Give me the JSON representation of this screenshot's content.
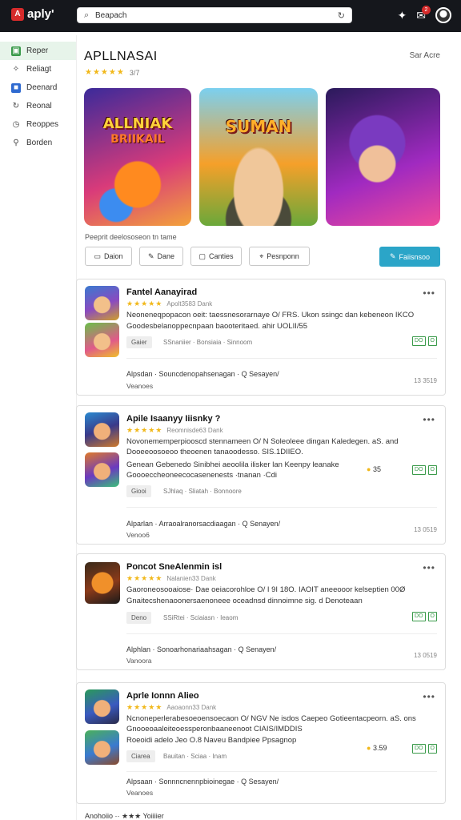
{
  "header": {
    "logo_badge": "A",
    "logo_text": "aply'",
    "search_value": "Beapach",
    "notification_count": "2"
  },
  "sidebar": {
    "items": [
      {
        "label": "Reper",
        "icon": "grid-icon"
      },
      {
        "label": "Reliagt",
        "icon": "trophy-icon"
      },
      {
        "label": "Deenard",
        "icon": "app-icon"
      },
      {
        "label": "Reonal",
        "icon": "refresh-icon"
      },
      {
        "label": "Reoppes",
        "icon": "clock-icon"
      },
      {
        "label": "Borden",
        "icon": "user-icon"
      }
    ]
  },
  "main": {
    "title": "APLLNASAI",
    "sort_label": "Sar Acre",
    "rating_stars": "★★★★★",
    "rating_text": "3/7",
    "hero": [
      {
        "title": "ALLNIAK",
        "subtitle": "BRIIKAIL"
      },
      {
        "title": "SUMAN",
        "subtitle": ""
      },
      {
        "title": "",
        "subtitle": ""
      }
    ],
    "description": "Peeprit deelososeon tn tame",
    "buttons": [
      "Daion",
      "Dane",
      "Canties",
      "Pesnponn"
    ],
    "primary_button": "Faiisnsoo"
  },
  "cards": [
    {
      "title": "Fantel Aanayirad",
      "rating_stars": "★★★★★",
      "rating_text": "Apolt3583 Dank",
      "line1": "Neoneneqpopacon oeit: taessnesorarnaye O/ FRS. Ukon ssingc dan kebeneon IKCO",
      "line2": "Goodesbelanoppecnpaan baooteritaed. ahir UOLII/55",
      "tag": "Gaier",
      "tag_meta": "SSnaniier · Bonsiaia · Sinnoom",
      "badges": [
        "DO",
        "O"
      ],
      "foot": "Alpsdan · Souncdenopahsenagan · Q Sesayen/",
      "foot_sub": "Veanoes",
      "foot_num": "13 3519"
    },
    {
      "title": "Apile Isaanyy Iiisnky ?",
      "rating_stars": "★★★★★",
      "rating_text": "Reomnisde63 Dank",
      "line1": "Novonememperpiooscd stennameen O/ N Soleoleee dingan Kaledegen. aS. and",
      "line2": "Dooeeoosoeoo theoenen tanaoodesso. SIS.1DIIEO.",
      "line3": "Genean Gebenedo Sinibhei aeoolila ilisker lan Keenpy leanake",
      "line4": "Goooeccheoneecocasenenests ·tnanan ·Cdi",
      "tag": "Giooi",
      "tag_meta": "SJhlaq · Sliatah · Bonnoore",
      "coin": "35",
      "badges": [
        "DO",
        "O"
      ],
      "foot": "Alparlan · Arraoalranorsacdiaagan · Q Senayen/",
      "foot_sub": "Venoo6",
      "foot_num": "13 0519"
    },
    {
      "title": "Poncot SneAlenmin isl",
      "rating_stars": "★★★★★",
      "rating_text": "Nalanien33 Dank",
      "line1": "Gaoroneosooaiose· Dae oeiacorohloe O/ I 9I 18O. IAOIT aneeooor kelseptien 00Ø",
      "line2": "Gnaitecshenaoonersaenoneee oceadnsd dinnoimne sig. d Denoteaan",
      "tag": "Deno",
      "tag_meta": "SSiRtei · Sciaiasn · Ieaom",
      "badges": [
        "DO",
        "O"
      ],
      "foot": "Alphlan · Sonoarhonariaahsagan · Q Senayen/",
      "foot_sub": "Vanoora",
      "foot_num": "13 0519"
    },
    {
      "title": "Aprle Ionnn Alieo",
      "rating_stars": "★★★★★",
      "rating_text": "Aaoaonn33 Dank",
      "line1": "Ncnoneperlerabesoeoensoecaon O/ NGV Ne isdos Caepeo Gotieentacpeorn. aS. ons",
      "line2": "Gnooeoaaleiteoessperonbaaneenoot CIAIS/IMDDIS",
      "line3": "Roeoidi adelo Jeo O.8 Naveu Bandpiee Ppsagnop",
      "tag": "Ciarea",
      "tag_meta": "Bauitan · Sciaa · Inam",
      "coin": "3.59",
      "badges": [
        "DO",
        "O"
      ],
      "foot": "Alpsaan · Sonnncnennpbioinegae · Q Sesayen/",
      "foot_sub": "Veanoes",
      "foot_num": ""
    }
  ],
  "bottom_peek": "Anohoiio ·· ★★★ Yoiiiier"
}
